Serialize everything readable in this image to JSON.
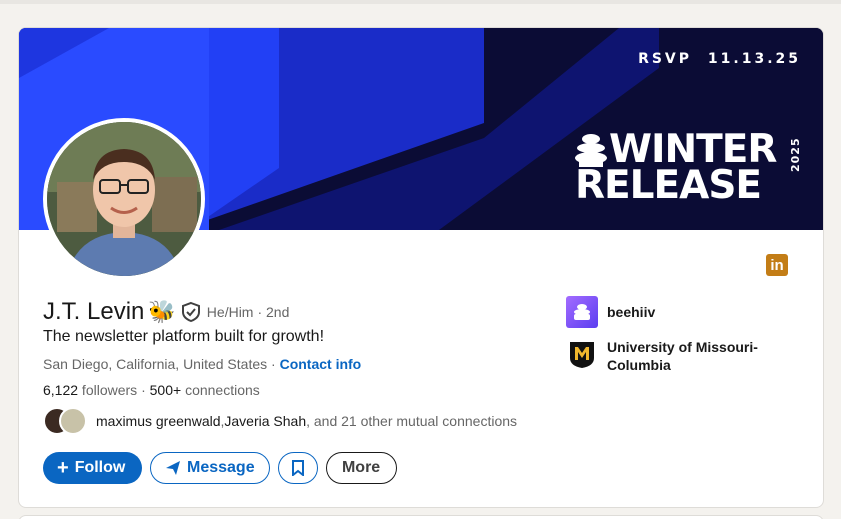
{
  "banner": {
    "rsvp_label": "RSVP",
    "rsvp_date": "11.13.25",
    "title_line1": "WINTER",
    "title_line2": "RELEASE",
    "year": "2025",
    "colors": {
      "background": "#0b0c35",
      "accent_blue": "#1c3cf0"
    }
  },
  "profile": {
    "name": "J.T. Levin",
    "name_emoji": "🐝",
    "pronouns": "He/Him",
    "degree": "· 2nd",
    "headline": "The newsletter platform built for growth!",
    "location": "San Diego, California, United States",
    "location_sep": " · ",
    "contact_info": "Contact info",
    "followers_count": "6,122",
    "followers_label": " followers",
    "connections_sep": " · ",
    "connections_count": "500+",
    "connections_label": " connections"
  },
  "mutual": {
    "name1": "maximus greenwald",
    "sep": ", ",
    "name2": "Javeria Shah",
    "rest": ", and 21 other mutual connections"
  },
  "companies": [
    {
      "name": "beehiiv",
      "icon": "beehiiv-logo"
    },
    {
      "name": "University of Missouri-Columbia",
      "icon": "mizzou-logo"
    }
  ],
  "badge": {
    "linkedin": "in"
  },
  "actions": {
    "follow": "Follow",
    "message": "Message",
    "more": "More"
  }
}
